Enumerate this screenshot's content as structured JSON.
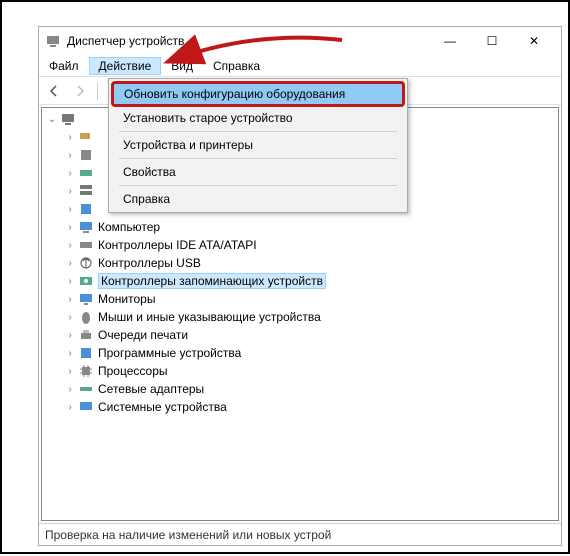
{
  "window": {
    "title": "Диспетчер устройств",
    "minimize": "—",
    "maximize": "☐",
    "close": "✕"
  },
  "menubar": {
    "file": "Файл",
    "action": "Действие",
    "view": "Вид",
    "help": "Справка"
  },
  "dropdown": {
    "update": "Обновить конфигурацию оборудования",
    "install": "Установить старое устройство",
    "devices": "Устройства и принтеры",
    "properties": "Свойства",
    "help": "Справка"
  },
  "tree": {
    "root": "",
    "computer": "Компьютер",
    "ide": "Контроллеры IDE ATA/ATAPI",
    "usb": "Контроллеры USB",
    "storage": "Контроллеры запоминающих устройств",
    "monitors": "Мониторы",
    "mouse": "Мыши и иные указывающие устройства",
    "print": "Очереди печати",
    "software": "Программные устройства",
    "cpu": "Процессоры",
    "network": "Сетевые адаптеры",
    "system": "Системные устройства"
  },
  "status": "Проверка на наличие изменений или новых устрой"
}
